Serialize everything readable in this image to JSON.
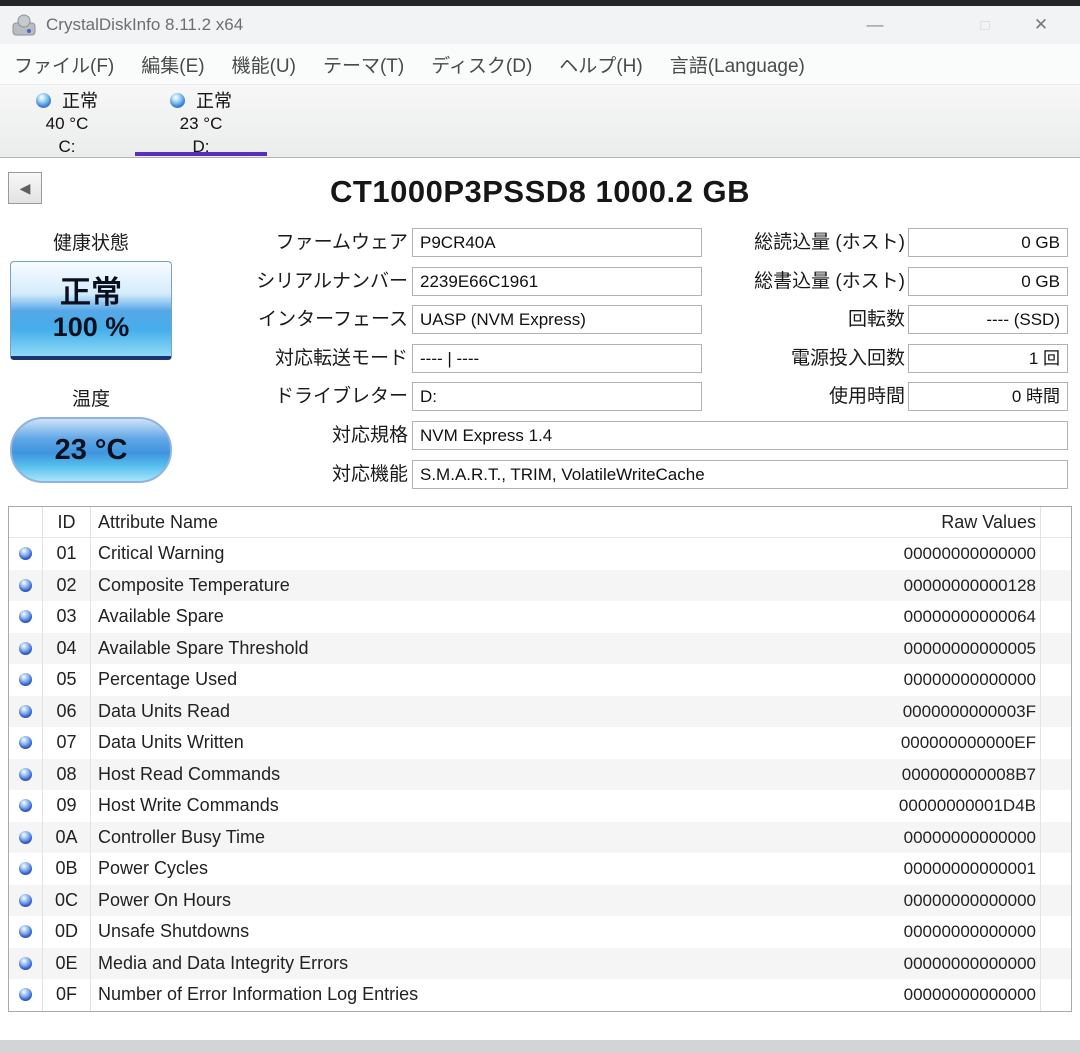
{
  "window": {
    "title": "CrystalDiskInfo 8.11.2 x64",
    "controls": {
      "minimize": "—",
      "maximize": "□",
      "close": "✕"
    }
  },
  "menu": {
    "items": [
      "ファイル(F)",
      "編集(E)",
      "機能(U)",
      "テーマ(T)",
      "ディスク(D)",
      "ヘルプ(H)",
      "言語(Language)"
    ]
  },
  "tabs": [
    {
      "status": "正常",
      "temp": "40 °C",
      "drive": "C:",
      "selected": false
    },
    {
      "status": "正常",
      "temp": "23 °C",
      "drive": "D:",
      "selected": true
    }
  ],
  "drive": {
    "title": "CT1000P3PSSD8 1000.2 GB",
    "back_glyph": "◀",
    "health": {
      "label": "健康状態",
      "status": "正常",
      "percent": "100 %"
    },
    "temperature": {
      "label": "温度",
      "value": "23 °C"
    },
    "fields_mid": [
      {
        "label": "ファームウェア",
        "value": "P9CR40A"
      },
      {
        "label": "シリアルナンバー",
        "value": "2239E66C1961"
      },
      {
        "label": "インターフェース",
        "value": "UASP (NVM Express)"
      },
      {
        "label": "対応転送モード",
        "value": "---- | ----"
      },
      {
        "label": "ドライブレター",
        "value": "D:"
      }
    ],
    "fields_right": [
      {
        "label": "総読込量 (ホスト)",
        "value": "0 GB"
      },
      {
        "label": "総書込量 (ホスト)",
        "value": "0 GB"
      },
      {
        "label": "回転数",
        "value": "---- (SSD)"
      },
      {
        "label": "電源投入回数",
        "value": "1 回"
      },
      {
        "label": "使用時間",
        "value": "0 時間"
      }
    ],
    "fields_wide": [
      {
        "label": "対応規格",
        "value": "NVM Express 1.4"
      },
      {
        "label": "対応機能",
        "value": "S.M.A.R.T., TRIM, VolatileWriteCache"
      }
    ]
  },
  "smart_table": {
    "headers": {
      "id": "ID",
      "name": "Attribute Name",
      "raw": "Raw Values"
    },
    "rows": [
      {
        "id": "01",
        "name": "Critical Warning",
        "raw": "00000000000000"
      },
      {
        "id": "02",
        "name": "Composite Temperature",
        "raw": "00000000000128"
      },
      {
        "id": "03",
        "name": "Available Spare",
        "raw": "00000000000064"
      },
      {
        "id": "04",
        "name": "Available Spare Threshold",
        "raw": "00000000000005"
      },
      {
        "id": "05",
        "name": "Percentage Used",
        "raw": "00000000000000"
      },
      {
        "id": "06",
        "name": "Data Units Read",
        "raw": "0000000000003F"
      },
      {
        "id": "07",
        "name": "Data Units Written",
        "raw": "000000000000EF"
      },
      {
        "id": "08",
        "name": "Host Read Commands",
        "raw": "000000000008B7"
      },
      {
        "id": "09",
        "name": "Host Write Commands",
        "raw": "00000000001D4B"
      },
      {
        "id": "0A",
        "name": "Controller Busy Time",
        "raw": "00000000000000"
      },
      {
        "id": "0B",
        "name": "Power Cycles",
        "raw": "00000000000001"
      },
      {
        "id": "0C",
        "name": "Power On Hours",
        "raw": "00000000000000"
      },
      {
        "id": "0D",
        "name": "Unsafe Shutdowns",
        "raw": "00000000000000"
      },
      {
        "id": "0E",
        "name": "Media and Data Integrity Errors",
        "raw": "00000000000000"
      },
      {
        "id": "0F",
        "name": "Number of Error Information Log Entries",
        "raw": "00000000000000"
      }
    ]
  },
  "colors": {
    "accent_tab_underline": "#5b2dbf",
    "health_good_blue": "#56a7e8",
    "orb_blue": "#4a7de0",
    "titlebar_bg": "#f1f3f4"
  }
}
